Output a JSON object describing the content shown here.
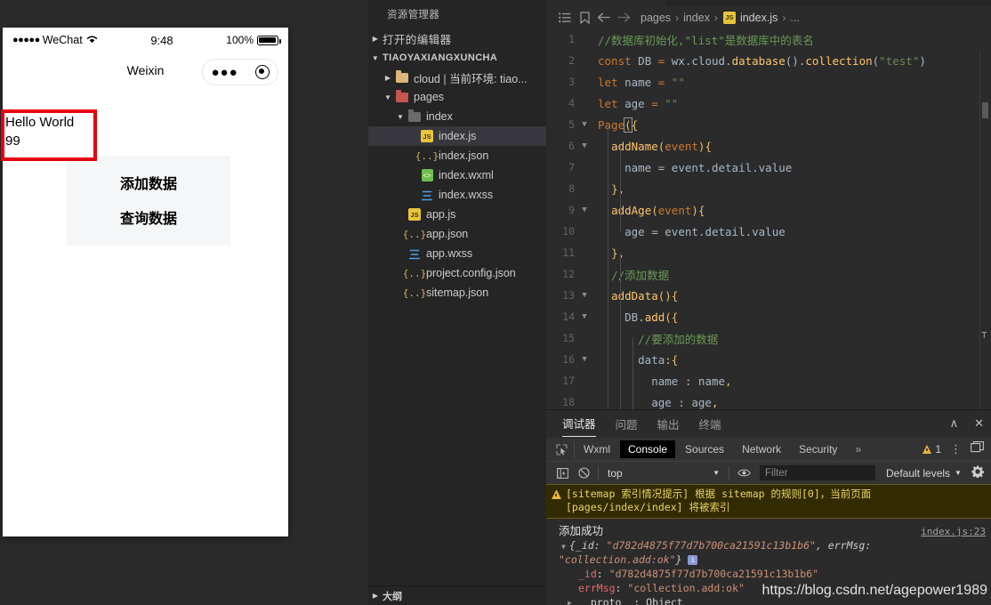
{
  "simulator": {
    "status_bar": {
      "signal_dots": "●●●●●",
      "carrier": "WeChat",
      "time": "9:48",
      "battery_percent": "100%"
    },
    "nav_title": "Weixin",
    "capsule": {
      "more_dots": "●●●"
    },
    "page_text_line1": "Hello World",
    "page_text_line2": "99",
    "buttons": [
      {
        "label": "添加数据"
      },
      {
        "label": "查询数据"
      }
    ],
    "highlight_color": "#e60012"
  },
  "explorer": {
    "title": "资源管理器",
    "open_editors_label": "打开的编辑器",
    "project_label": "TIAOYAXIANGXUNCHA",
    "tree": [
      {
        "label": "cloud | 当前环境: tiao...",
        "icon": "folder-yellow-icon",
        "indent": 1,
        "arrow": "right",
        "type": "folder"
      },
      {
        "label": "pages",
        "icon": "folder-red-icon",
        "indent": 1,
        "arrow": "down",
        "type": "folder"
      },
      {
        "label": "index",
        "icon": "folder-grey-icon",
        "indent": 2,
        "arrow": "down",
        "type": "folder"
      },
      {
        "label": "index.js",
        "icon": "js-file-icon",
        "indent": 3,
        "arrow": "blank",
        "type": "file",
        "active": true
      },
      {
        "label": "index.json",
        "icon": "json-file-icon",
        "indent": 3,
        "arrow": "blank",
        "type": "file"
      },
      {
        "label": "index.wxml",
        "icon": "wxml-file-icon",
        "indent": 3,
        "arrow": "blank",
        "type": "file"
      },
      {
        "label": "index.wxss",
        "icon": "wxss-file-icon",
        "indent": 3,
        "arrow": "blank",
        "type": "file"
      },
      {
        "label": "app.js",
        "icon": "js-file-icon",
        "indent": 2,
        "arrow": "blank",
        "type": "file"
      },
      {
        "label": "app.json",
        "icon": "json-file-icon",
        "indent": 2,
        "arrow": "blank",
        "type": "file"
      },
      {
        "label": "app.wxss",
        "icon": "wxss-file-icon",
        "indent": 2,
        "arrow": "blank",
        "type": "file"
      },
      {
        "label": "project.config.json",
        "icon": "json-file-icon",
        "indent": 2,
        "arrow": "blank",
        "type": "file"
      },
      {
        "label": "sitemap.json",
        "icon": "json-file-icon",
        "indent": 2,
        "arrow": "blank",
        "type": "file"
      }
    ],
    "outline_label": "大纲"
  },
  "editor": {
    "breadcrumb": [
      "pages",
      "index",
      "index.js",
      "..."
    ],
    "lines": [
      {
        "n": "1",
        "fold": "",
        "indent": 0,
        "tokens": [
          {
            "t": "//数据库初始化,\"list\"是数据库中的表名",
            "c": "k-com"
          }
        ]
      },
      {
        "n": "2",
        "fold": "",
        "indent": 0,
        "tokens": [
          {
            "t": "const",
            "c": "k-key"
          },
          {
            "t": " DB ",
            "c": "k-var"
          },
          {
            "t": "=",
            "c": "k-key"
          },
          {
            "t": " wx",
            "c": "k-var"
          },
          {
            "t": ".",
            "c": "k-pun"
          },
          {
            "t": "cloud",
            "c": "k-var"
          },
          {
            "t": ".",
            "c": "k-pun"
          },
          {
            "t": "database",
            "c": "k-fn"
          },
          {
            "t": "()",
            "c": "k-pun"
          },
          {
            "t": ".",
            "c": "k-pun"
          },
          {
            "t": "collection",
            "c": "k-fn"
          },
          {
            "t": "(",
            "c": "k-pun"
          },
          {
            "t": "\"test\"",
            "c": "k-str"
          },
          {
            "t": ")",
            "c": "k-pun"
          }
        ]
      },
      {
        "n": "3",
        "fold": "",
        "indent": 0,
        "tokens": [
          {
            "t": "let",
            "c": "k-key"
          },
          {
            "t": " name ",
            "c": "k-var"
          },
          {
            "t": "=",
            "c": "k-key"
          },
          {
            "t": " ",
            "c": "k-var"
          },
          {
            "t": "\"\"",
            "c": "k-str"
          }
        ]
      },
      {
        "n": "4",
        "fold": "",
        "indent": 0,
        "tokens": [
          {
            "t": "let",
            "c": "k-key"
          },
          {
            "t": " age ",
            "c": "k-var"
          },
          {
            "t": "=",
            "c": "k-key"
          },
          {
            "t": " ",
            "c": "k-var"
          },
          {
            "t": "\"\"",
            "c": "k-str"
          }
        ]
      },
      {
        "n": "5",
        "fold": "v",
        "indent": 0,
        "tokens": [
          {
            "t": "Page",
            "c": "k-orange"
          },
          {
            "t": "(",
            "c": "cursor"
          },
          {
            "t": "{",
            "c": "k-yel"
          }
        ]
      },
      {
        "n": "6",
        "fold": "v",
        "indent": 1,
        "tokens": [
          {
            "t": "addName",
            "c": "k-fn"
          },
          {
            "t": "(",
            "c": "k-yel"
          },
          {
            "t": "event",
            "c": "k-orange"
          },
          {
            "t": "){",
            "c": "k-yel"
          }
        ]
      },
      {
        "n": "7",
        "fold": "",
        "indent": 2,
        "tokens": [
          {
            "t": "name ",
            "c": "k-var"
          },
          {
            "t": "=",
            "c": "k-pun"
          },
          {
            "t": " event",
            "c": "k-var"
          },
          {
            "t": ".",
            "c": "k-pun"
          },
          {
            "t": "detail",
            "c": "k-var"
          },
          {
            "t": ".",
            "c": "k-pun"
          },
          {
            "t": "value",
            "c": "k-var"
          }
        ]
      },
      {
        "n": "8",
        "fold": "",
        "indent": 1,
        "tokens": [
          {
            "t": "},",
            "c": "k-yel"
          }
        ]
      },
      {
        "n": "9",
        "fold": "v",
        "indent": 1,
        "tokens": [
          {
            "t": "addAge",
            "c": "k-fn"
          },
          {
            "t": "(",
            "c": "k-yel"
          },
          {
            "t": "event",
            "c": "k-orange"
          },
          {
            "t": "){",
            "c": "k-yel"
          }
        ]
      },
      {
        "n": "10",
        "fold": "",
        "indent": 2,
        "tokens": [
          {
            "t": "age ",
            "c": "k-var"
          },
          {
            "t": "=",
            "c": "k-pun"
          },
          {
            "t": " event",
            "c": "k-var"
          },
          {
            "t": ".",
            "c": "k-pun"
          },
          {
            "t": "detail",
            "c": "k-var"
          },
          {
            "t": ".",
            "c": "k-pun"
          },
          {
            "t": "value",
            "c": "k-var"
          }
        ]
      },
      {
        "n": "11",
        "fold": "",
        "indent": 1,
        "tokens": [
          {
            "t": "},",
            "c": "k-yel"
          }
        ]
      },
      {
        "n": "12",
        "fold": "",
        "indent": 1,
        "tokens": [
          {
            "t": "//添加数据",
            "c": "k-com"
          }
        ]
      },
      {
        "n": "13",
        "fold": "v",
        "indent": 1,
        "tokens": [
          {
            "t": "addData",
            "c": "k-fn"
          },
          {
            "t": "(){",
            "c": "k-yel"
          }
        ]
      },
      {
        "n": "14",
        "fold": "v",
        "indent": 2,
        "tokens": [
          {
            "t": "DB",
            "c": "k-var"
          },
          {
            "t": ".",
            "c": "k-pun"
          },
          {
            "t": "add",
            "c": "k-fn"
          },
          {
            "t": "({",
            "c": "k-yel"
          }
        ]
      },
      {
        "n": "15",
        "fold": "",
        "indent": 3,
        "tokens": [
          {
            "t": "//要添加的数据",
            "c": "k-com"
          }
        ]
      },
      {
        "n": "16",
        "fold": "v",
        "indent": 3,
        "tokens": [
          {
            "t": "data",
            "c": "k-var"
          },
          {
            "t": ":{",
            "c": "k-yel"
          }
        ]
      },
      {
        "n": "17",
        "fold": "",
        "indent": 4,
        "tokens": [
          {
            "t": "name ",
            "c": "k-var"
          },
          {
            "t": ":",
            "c": "k-pun"
          },
          {
            "t": " name",
            "c": "k-var"
          },
          {
            "t": ",",
            "c": "k-yel"
          }
        ]
      },
      {
        "n": "18",
        "fold": "",
        "indent": 4,
        "tokens": [
          {
            "t": "age ",
            "c": "k-var"
          },
          {
            "t": ":",
            "c": "k-pun"
          },
          {
            "t": " age",
            "c": "k-var"
          },
          {
            "t": ",",
            "c": "k-yel"
          }
        ]
      }
    ]
  },
  "debug": {
    "panel_tabs": [
      {
        "label": "调试器",
        "selected": true
      },
      {
        "label": "问题",
        "selected": false
      },
      {
        "label": "输出",
        "selected": false
      },
      {
        "label": "终端",
        "selected": false
      }
    ],
    "panel_actions": {
      "collapse": "∧",
      "close": "✕"
    },
    "devtool_tabs": [
      {
        "label": "Wxml",
        "selected": false
      },
      {
        "label": "Console",
        "selected": true
      },
      {
        "label": "Sources",
        "selected": false
      },
      {
        "label": "Network",
        "selected": false
      },
      {
        "label": "Security",
        "selected": false
      }
    ],
    "devtool_more": "»",
    "warning_count": "1",
    "console_toolbar": {
      "context": "top",
      "filter_placeholder": "Filter",
      "levels": "Default levels"
    },
    "warning_message_line1": "[sitemap 索引情况提示] 根据 sitemap 的规则[0]，当前页面",
    "warning_message_line2": "[pages/index/index] 将被索引",
    "log": {
      "message": "添加成功",
      "source": "index.js:23",
      "preview_prefix": "{_id: ",
      "preview_id": "\"d782d4875f77d7b700ca21591c13b1b6\"",
      "preview_mid": ", errMsg: ",
      "preview_err": "\"collection.add:ok\"",
      "preview_suffix": "}",
      "info_badge": "i",
      "rows": [
        {
          "key": "_id",
          "sep": ": ",
          "value": "\"d782d4875f77d7b700ca21591c13b1b6\""
        },
        {
          "key": "errMsg",
          "sep": ": ",
          "value": "\"collection.add:ok\""
        }
      ],
      "proto_key": "__proto__",
      "proto_value": "Object"
    },
    "watermark": "https://blog.csdn.net/agepower1989"
  }
}
